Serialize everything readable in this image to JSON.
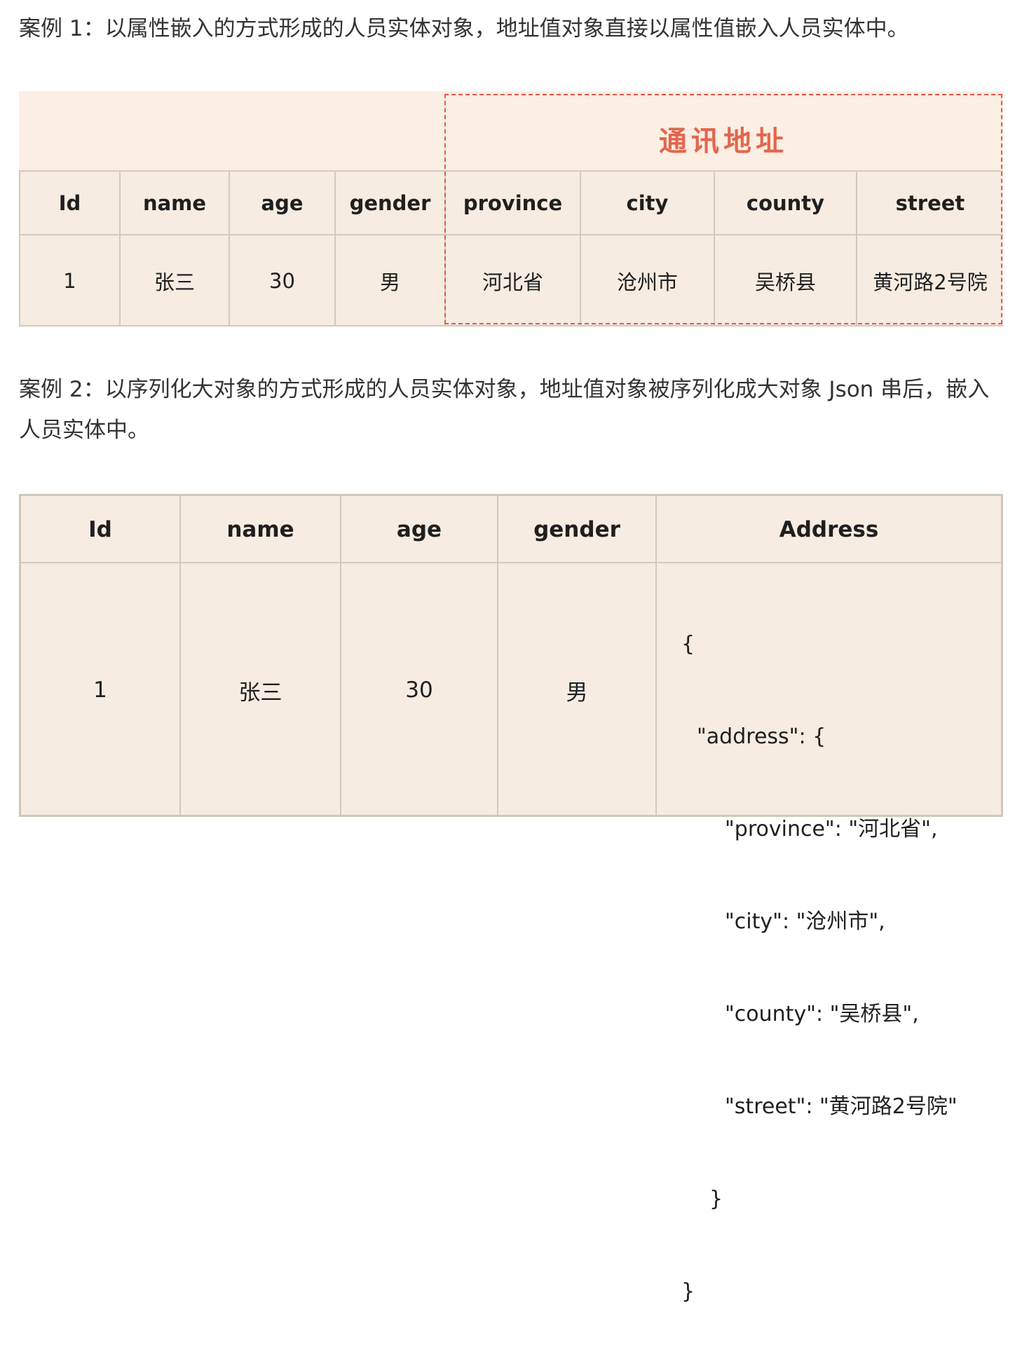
{
  "case1": {
    "text": "案例 1：以属性嵌入的方式形成的人员实体对象，地址值对象直接以属性值嵌入人员实体中。",
    "group_title": "通讯地址",
    "headers": [
      "Id",
      "name",
      "age",
      "gender",
      "province",
      "city",
      "county",
      "street"
    ],
    "row": [
      "1",
      "张三",
      "30",
      "男",
      "河北省",
      "沧州市",
      "吴桥县",
      "黄河路2号院"
    ],
    "dashed_color": "#e8574a",
    "title_color": "#e2664d"
  },
  "case2": {
    "text": "案例 2：以序列化大对象的方式形成的人员实体对象，地址值对象被序列化成大对象 Json 串后，嵌入人员实体中。",
    "headers": [
      "Id",
      "name",
      "age",
      "gender",
      "Address"
    ],
    "row": [
      "1",
      "张三",
      "30",
      "男"
    ],
    "json_lines": [
      "{",
      "\"address\": {",
      "\"province\": \"河北省\",",
      "\"city\": \"沧州市\",",
      "\"county\": \"吴桥县\",",
      "\"street\": \"黄河路2号院\"",
      "}",
      "}"
    ]
  },
  "colors": {
    "table_bg": "#f6ece1",
    "band_bg": "#fbeee3",
    "border": "#d2c9be"
  }
}
